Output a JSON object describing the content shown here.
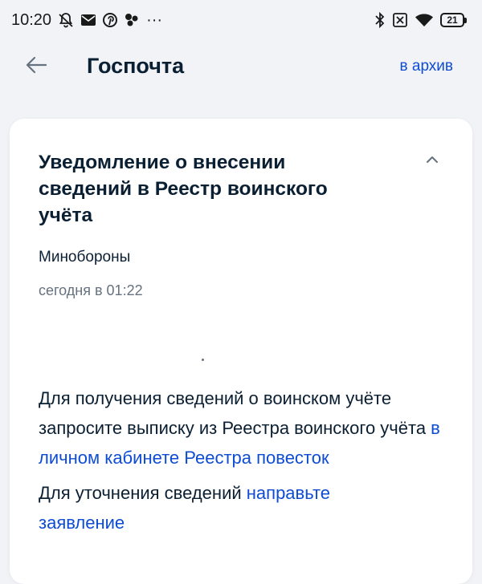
{
  "status_bar": {
    "time": "10:20",
    "more": "···",
    "battery": "21",
    "left_icons": [
      "bell-off-icon",
      "mail-icon",
      "pinterest-icon",
      "dots-cluster-icon"
    ],
    "right_icons": [
      "bluetooth-icon",
      "no-sim-icon",
      "wifi-icon",
      "battery-icon"
    ]
  },
  "header": {
    "title": "Госпочта",
    "archive_label": "в архив",
    "back_icon": "arrow-left-icon"
  },
  "message": {
    "title": "Уведомление о внесении сведений в Реестр воинского учёта",
    "sender": "Минобороны",
    "date": "сегодня в 01:22",
    "collapse_icon": "chevron-up-icon",
    "paragraph1": {
      "text": "Для получения сведений о воинском учёте запросите выписку из Реестра воинского учёта ",
      "link": "в личном кабинете Реестра повесток"
    },
    "paragraph2": {
      "text": "Для уточнения сведений ",
      "link": "направьте заявление"
    }
  },
  "colors": {
    "background": "#f1f3f6",
    "card": "#ffffff",
    "text": "#0b1f33",
    "secondary_text": "#66727f",
    "link": "#0d4cd3"
  }
}
